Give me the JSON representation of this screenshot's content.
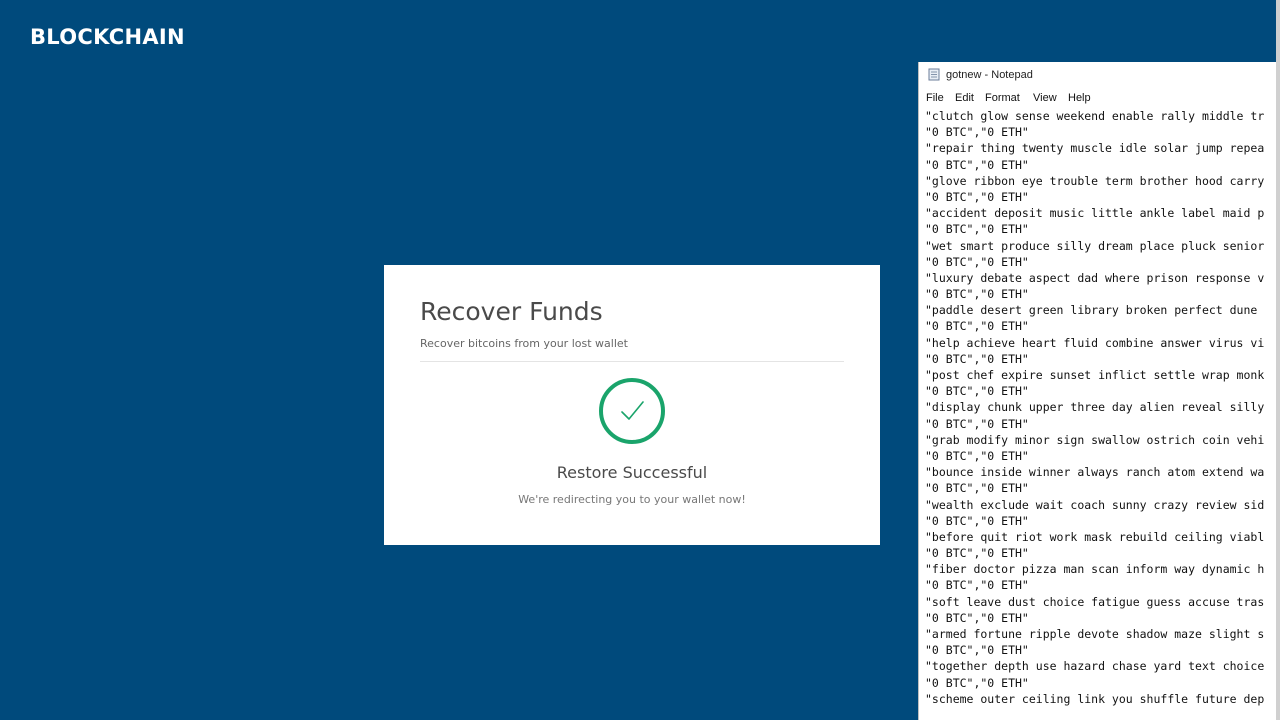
{
  "brand": {
    "logo_text": "BLOCKCHAIN"
  },
  "recover_card": {
    "title": "Recover Funds",
    "subtitle": "Recover bitcoins from your lost wallet",
    "status_title": "Restore Successful",
    "status_text": "We're redirecting you to your wallet now!",
    "success_color": "#1aa46b"
  },
  "notepad": {
    "title": "gotnew - Notepad",
    "menu": [
      "File",
      "Edit",
      "Format",
      "View",
      "Help"
    ],
    "lines": [
      "\"clutch glow sense weekend enable rally middle tr",
      "\"0 BTC\",\"0 ETH\"",
      "\"repair thing twenty muscle idle solar jump repea",
      "\"0 BTC\",\"0 ETH\"",
      "\"glove ribbon eye trouble term brother hood carry",
      "\"0 BTC\",\"0 ETH\"",
      "\"accident deposit music little ankle label maid p",
      "\"0 BTC\",\"0 ETH\"",
      "\"wet smart produce silly dream place pluck senior",
      "\"0 BTC\",\"0 ETH\"",
      "\"luxury debate aspect dad where prison response v",
      "\"0 BTC\",\"0 ETH\"",
      "\"paddle desert green library broken perfect dune ",
      "\"0 BTC\",\"0 ETH\"",
      "\"help achieve heart fluid combine answer virus vi",
      "\"0 BTC\",\"0 ETH\"",
      "\"post chef expire sunset inflict settle wrap monk",
      "\"0 BTC\",\"0 ETH\"",
      "\"display chunk upper three day alien reveal silly",
      "\"0 BTC\",\"0 ETH\"",
      "\"grab modify minor sign swallow ostrich coin vehi",
      "\"0 BTC\",\"0 ETH\"",
      "\"bounce inside winner always ranch atom extend wa",
      "\"0 BTC\",\"0 ETH\"",
      "\"wealth exclude wait coach sunny crazy review sid",
      "\"0 BTC\",\"0 ETH\"",
      "\"before quit riot work mask rebuild ceiling viabl",
      "\"0 BTC\",\"0 ETH\"",
      "\"fiber doctor pizza man scan inform way dynamic h",
      "\"0 BTC\",\"0 ETH\"",
      "\"soft leave dust choice fatigue guess accuse tras",
      "\"0 BTC\",\"0 ETH\"",
      "\"armed fortune ripple devote shadow maze slight s",
      "\"0 BTC\",\"0 ETH\"",
      "\"together depth use hazard chase yard text choice",
      "\"0 BTC\",\"0 ETH\"",
      "\"scheme outer ceiling link you shuffle future dep"
    ]
  }
}
